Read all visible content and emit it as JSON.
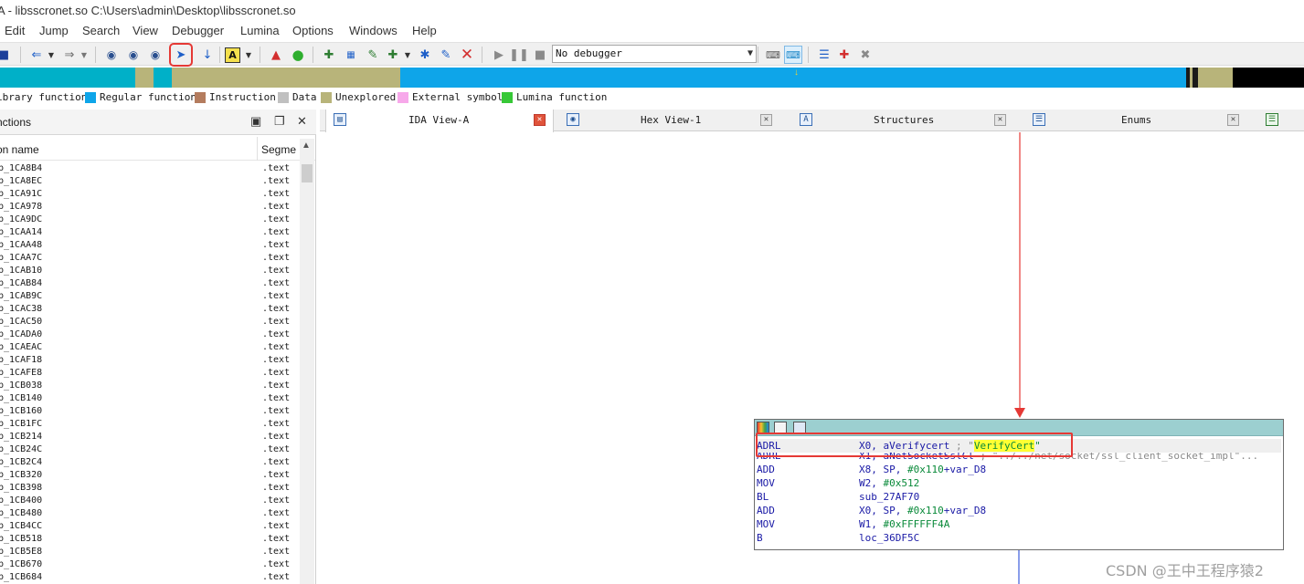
{
  "window": {
    "title": "A - libsscronet.so C:\\Users\\admin\\Desktop\\libsscronet.so"
  },
  "menu": [
    "Edit",
    "Jump",
    "Search",
    "View",
    "Debugger",
    "Lumina",
    "Options",
    "Windows",
    "Help"
  ],
  "toolbar": {
    "debugger_select": "No debugger",
    "icons": [
      "save-icon",
      "back-arrow-icon",
      "forward-arrow-icon",
      "binoculars-icon",
      "binoculars-next-icon",
      "binoculars-text-icon",
      "search-immediate-icon",
      "jump-down-arrow-icon",
      "text-search-icon",
      "warning-icon",
      "green-ball-icon",
      "add-segment-icon",
      "hex-icon",
      "assembly-icon",
      "add-node-icon",
      "cross-node-icon",
      "edit-icon",
      "delete-icon",
      "play-icon",
      "pause-icon",
      "stop-icon",
      "cpu-code-icon",
      "cpu-step-icon",
      "list-icon",
      "add-breakpoint-icon",
      "remove-breakpoint-icon"
    ]
  },
  "colors": {
    "library_function": "#00b0c8",
    "regular_function": "#0ea5e9",
    "instruction": "#b47c5e",
    "data": "#c0c0c0",
    "unexplored": "#b8b47a",
    "external_symbol": "#f7a8ea",
    "lumina_function": "#37c837",
    "highlight": "#e53935"
  },
  "legend": [
    {
      "label": "ibrary function",
      "color": ""
    },
    {
      "label": "Regular function",
      "color": "#0ea5e9"
    },
    {
      "label": "Instruction",
      "color": "#b47c5e"
    },
    {
      "label": "Data",
      "color": "#c0c0c0"
    },
    {
      "label": "Unexplored",
      "color": "#b8b47a"
    },
    {
      "label": "External symbol",
      "color": "#f7a8ea"
    },
    {
      "label": "Lumina function",
      "color": "#37c837"
    }
  ],
  "functions_panel": {
    "title": "nctions",
    "col_name": "on name",
    "col_segment": "Segme",
    "rows": [
      {
        "name": "b_1CA8B4",
        "seg": ".text"
      },
      {
        "name": "b_1CA8EC",
        "seg": ".text"
      },
      {
        "name": "b_1CA91C",
        "seg": ".text"
      },
      {
        "name": "b_1CA978",
        "seg": ".text"
      },
      {
        "name": "b_1CA9DC",
        "seg": ".text"
      },
      {
        "name": "b_1CAA14",
        "seg": ".text"
      },
      {
        "name": "b_1CAA48",
        "seg": ".text"
      },
      {
        "name": "b_1CAA7C",
        "seg": ".text"
      },
      {
        "name": "b_1CAB10",
        "seg": ".text"
      },
      {
        "name": "b_1CAB84",
        "seg": ".text"
      },
      {
        "name": "b_1CAB9C",
        "seg": ".text"
      },
      {
        "name": "b_1CAC38",
        "seg": ".text"
      },
      {
        "name": "b_1CAC50",
        "seg": ".text"
      },
      {
        "name": "b_1CADA0",
        "seg": ".text"
      },
      {
        "name": "b_1CAEAC",
        "seg": ".text"
      },
      {
        "name": "b_1CAF18",
        "seg": ".text"
      },
      {
        "name": "b_1CAFE8",
        "seg": ".text"
      },
      {
        "name": "b_1CB038",
        "seg": ".text"
      },
      {
        "name": "b_1CB140",
        "seg": ".text"
      },
      {
        "name": "b_1CB160",
        "seg": ".text"
      },
      {
        "name": "b_1CB1FC",
        "seg": ".text"
      },
      {
        "name": "b_1CB214",
        "seg": ".text"
      },
      {
        "name": "b_1CB24C",
        "seg": ".text"
      },
      {
        "name": "b_1CB2C4",
        "seg": ".text"
      },
      {
        "name": "b_1CB320",
        "seg": ".text"
      },
      {
        "name": "b_1CB398",
        "seg": ".text"
      },
      {
        "name": "b_1CB400",
        "seg": ".text"
      },
      {
        "name": "b_1CB480",
        "seg": ".text"
      },
      {
        "name": "b_1CB4CC",
        "seg": ".text"
      },
      {
        "name": "b_1CB518",
        "seg": ".text"
      },
      {
        "name": "b_1CB5E8",
        "seg": ".text"
      },
      {
        "name": "b_1CB670",
        "seg": ".text"
      },
      {
        "name": "b_1CB684",
        "seg": ".text"
      }
    ]
  },
  "tabs": [
    {
      "label": "IDA View-A",
      "active": true,
      "icon": "ida-view-icon"
    },
    {
      "label": "Hex View-1",
      "active": false,
      "icon": "hex-view-icon"
    },
    {
      "label": "Structures",
      "active": false,
      "icon": "structures-icon"
    },
    {
      "label": "Enums",
      "active": false,
      "icon": "enums-icon"
    }
  ],
  "code_block": {
    "lines": [
      {
        "mnemonic": "ADRL",
        "operands": "X0, aVerifycert",
        "comment": " ; \"",
        "string": "VerifyCert",
        "tail": "\"",
        "selected": true
      },
      {
        "mnemonic": "ADRL",
        "operands": "X1, aNetSocketSslCl",
        "comment": " ; \"../../net/socket/ssl_client_socket_impl\"...",
        "partial": true
      },
      {
        "mnemonic": "ADD",
        "operands": "X8, SP, #0x110+var_D8"
      },
      {
        "mnemonic": "MOV",
        "operands": "W2, #0x512"
      },
      {
        "mnemonic": "BL",
        "operands": "sub_27AF70"
      },
      {
        "mnemonic": "ADD",
        "operands": "X0, SP, #0x110+var_D8"
      },
      {
        "mnemonic": "MOV",
        "operands": "W1, #0xFFFFFF4A"
      },
      {
        "mnemonic": "B",
        "operands": "loc_36DF5C"
      }
    ]
  },
  "watermark": "CSDN @王中王程序猿2"
}
